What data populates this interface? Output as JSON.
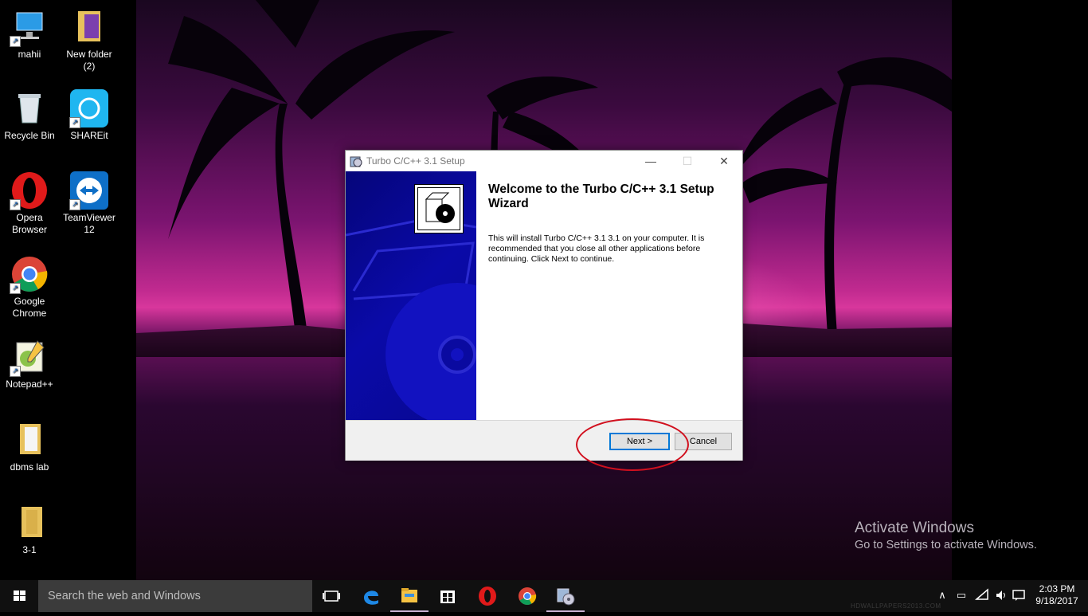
{
  "desktop": {
    "icons": [
      {
        "label": "mahii",
        "icon": "computer-icon"
      },
      {
        "label": "New folder\n(2)",
        "icon": "folder-icon"
      },
      {
        "label": "Recycle Bin",
        "icon": "recycle-bin-icon"
      },
      {
        "label": "SHAREit",
        "icon": "shareit-icon"
      },
      {
        "label": "Opera\nBrowser",
        "icon": "opera-icon"
      },
      {
        "label": "TeamViewer\n12",
        "icon": "teamviewer-icon"
      },
      {
        "label": "Google\nChrome",
        "icon": "chrome-icon"
      },
      {
        "label": "Notepad++",
        "icon": "notepadpp-icon"
      },
      {
        "label": "dbms lab",
        "icon": "folder-icon"
      },
      {
        "label": "3-1",
        "icon": "folder-icon"
      }
    ],
    "activate": {
      "title": "Activate Windows",
      "subtitle": "Go to Settings to activate Windows."
    },
    "wallpaper_watermark": "HDWALLPAPERS2013.COM"
  },
  "dialog": {
    "title": "Turbo C/C++ 3.1 Setup",
    "minimize": "—",
    "maximize": "☐",
    "close": "✕",
    "heading": "Welcome to the Turbo C/C++ 3.1 Setup Wizard",
    "body": "This will install Turbo C/C++ 3.1 3.1 on your computer. It is recommended that you close all other applications before continuing. Click Next to continue.",
    "next_label": "Next >",
    "cancel_label": "Cancel"
  },
  "taskbar": {
    "search_placeholder": "Search the web and Windows",
    "apps": [
      "task-view-icon",
      "edge-icon",
      "file-explorer-icon",
      "store-icon",
      "opera-icon",
      "chrome-icon",
      "setup-icon"
    ],
    "time": "2:03 PM",
    "date": "9/18/2017"
  },
  "colors": {
    "annotation": "#d1101e",
    "accent": "#0078d7",
    "banner": "#0a0aa8"
  }
}
